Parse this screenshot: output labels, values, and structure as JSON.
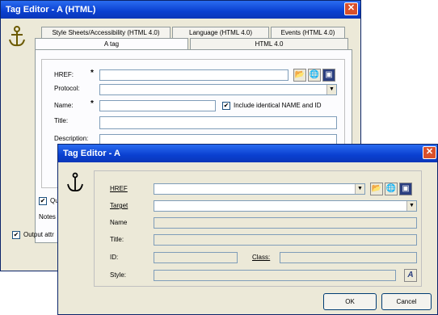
{
  "back_window": {
    "title": "Tag Editor - A   (HTML)",
    "tabs_row1": [
      "Style Sheets/Accessibility (HTML 4.0)",
      "Language (HTML 4.0)",
      "Events (HTML 4.0)"
    ],
    "tabs_row2": [
      "A tag",
      "HTML 4.0"
    ],
    "fields": {
      "href": "HREF:",
      "protocol": "Protocol:",
      "name": "Name:",
      "title": "Title:",
      "description": "Description:"
    },
    "include_identical": "Include identical NAME and ID",
    "partial_checkbox": "Qu",
    "notes": "Notes",
    "output_attr": "Output attr"
  },
  "front_window": {
    "title": "Tag Editor - A",
    "fields": {
      "href": "HREF",
      "target": "Target",
      "name": "Name",
      "title": "Title:",
      "id": "ID:",
      "class": "Class:",
      "style": "Style:"
    },
    "ok": "OK",
    "cancel": "Cancel"
  }
}
